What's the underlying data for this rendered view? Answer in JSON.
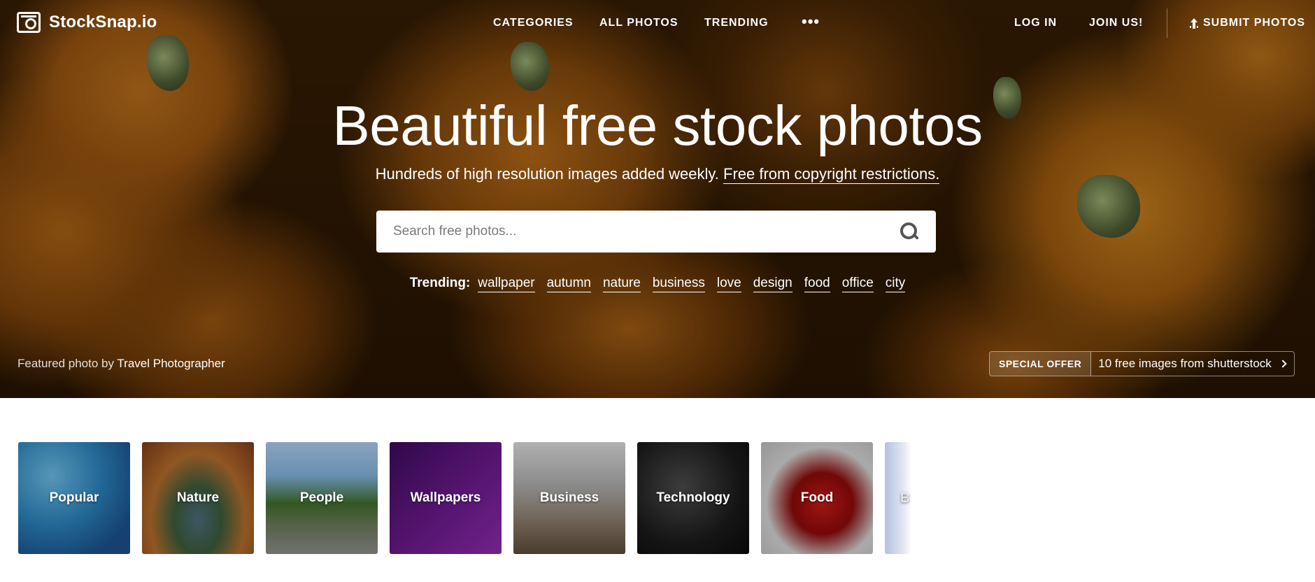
{
  "header": {
    "logo_text": "StockSnap.io",
    "nav": {
      "categories": "CATEGORIES",
      "all_photos": "ALL PHOTOS",
      "trending": "TRENDING",
      "more": "•••",
      "login": "LOG IN",
      "join": "JOIN US!",
      "submit": "SUBMIT PHOTOS"
    }
  },
  "hero": {
    "headline": "Beautiful free stock photos",
    "subline": "Hundreds of high resolution images added weekly.",
    "subline_link": "Free from copyright restrictions.",
    "search": {
      "placeholder": "Search free photos..."
    },
    "trending_label": "Trending:",
    "trending_tags": [
      "wallpaper",
      "autumn",
      "nature",
      "business",
      "love",
      "design",
      "food",
      "office",
      "city"
    ],
    "credit_prefix": "Featured photo by",
    "credit_author": "Travel Photographer",
    "offer": {
      "badge": "SPECIAL OFFER",
      "text": "10 free images from shutterstock"
    }
  },
  "categories": [
    "Popular",
    "Nature",
    "People",
    "Wallpapers",
    "Business",
    "Technology",
    "Food",
    "B"
  ]
}
